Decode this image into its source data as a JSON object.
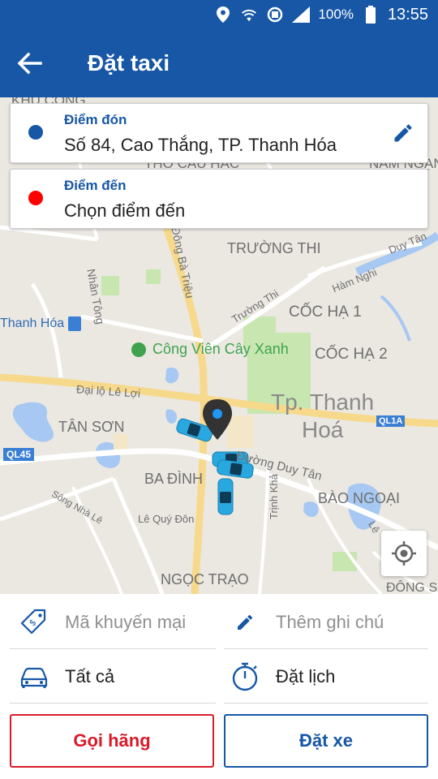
{
  "status_bar": {
    "battery": "100%",
    "time": "13:55",
    "icons": [
      "location-icon",
      "wifi-icon",
      "data-saver-icon",
      "signal-icon",
      "battery-icon"
    ]
  },
  "header": {
    "title": "Đặt taxi",
    "back_icon": "arrow-back-icon"
  },
  "pickup": {
    "label": "Điểm đón",
    "value": "Số 84, Cao Thắng, TP. Thanh Hóa",
    "dot_color": "#1757a6",
    "edit_icon": "pencil-icon"
  },
  "destination": {
    "label": "Điểm đến",
    "value": "Chọn điểm đến",
    "dot_color": "#ff0000"
  },
  "map": {
    "labels": {
      "khu_cong": "KHU CÔNG",
      "tho_cau_hac": "THỌ CẦU HẠC",
      "nam_ngan": "NAM NGẠN",
      "truong_thi": "TRƯỜNG THI",
      "nhan_tong": "Nhân Tông",
      "ba_trieu": "Đông Bà Triệu",
      "duy_tan_top": "Duy Tân",
      "ham_nghi": "Hàm Nghi",
      "truong_thi_road": "Trường Thi",
      "coc_ha_1": "CỐC HẠ 1",
      "coc_ha_2": "CỐC HẠ 2",
      "thanh_hoa": "Thanh Hóa",
      "cong_vien": "Công Viên Cây Xanh",
      "dai_lo": "Đại lộ Lê Lợi",
      "tp_thanh_1": "Tp. Thanh",
      "tp_thanh_2": "Hoá",
      "ql1a": "QL1A",
      "tan_son": "TÂN SƠN",
      "ql45": "QL45",
      "duy_tan_mid": "Đường Duy Tân",
      "ba_dinh": "BA ĐÌNH",
      "bao_ngoai": "BÀO NGOẠI",
      "song_nha_le": "Sông Nhà Lê",
      "le_quy_don": "Lê Quý Đôn",
      "trinh_kha": "Trịnh Khả",
      "le_right": "Lê",
      "ngoc_trao": "NGỌC TRẠO",
      "dong_son": "ĐÔNG S"
    },
    "locate_icon": "my-location-icon"
  },
  "options": {
    "promo": {
      "label": "Mã khuyến mại",
      "icon": "promo-tag-icon"
    },
    "note": {
      "label": "Thêm ghi chú",
      "icon": "pencil-icon"
    },
    "vehicle": {
      "label": "Tất cả",
      "icon": "car-icon"
    },
    "schedule": {
      "label": "Đặt lịch",
      "icon": "stopwatch-icon"
    }
  },
  "actions": {
    "call_company": "Gọi hãng",
    "book": "Đặt xe"
  },
  "colors": {
    "primary": "#1757a6",
    "danger": "#d81b2a",
    "taxi": "#29a8e0"
  }
}
